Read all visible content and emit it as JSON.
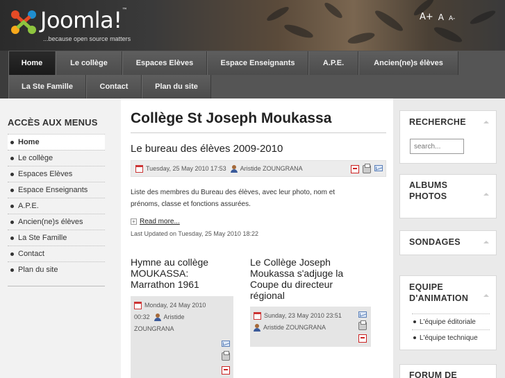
{
  "header": {
    "logo_text": "Joomla!",
    "logo_tm": "™",
    "tagline": "...because open source matters",
    "font_size": {
      "bigger": "A+",
      "reset": "A",
      "smaller": "A-"
    }
  },
  "nav": {
    "items": [
      {
        "label": "Home",
        "active": true
      },
      {
        "label": "Le collège"
      },
      {
        "label": "Espaces Elèves"
      },
      {
        "label": "Espace Enseignants"
      },
      {
        "label": "A.P.E."
      },
      {
        "label": "Ancien(ne)s élèves"
      },
      {
        "label": "La Ste Famille"
      },
      {
        "label": "Contact"
      },
      {
        "label": "Plan du site"
      }
    ]
  },
  "left": {
    "title": "ACCÈS AUX MENUS",
    "items": [
      "Home",
      "Le collège",
      "Espaces Elèves",
      "Espace Enseignants",
      "A.P.E.",
      "Ancien(ne)s élèves",
      "La Ste Famille",
      "Contact",
      "Plan du site"
    ]
  },
  "main": {
    "title": "Collège St Joseph Moukassa",
    "article": {
      "title": "Le bureau des élèves 2009-2010",
      "date": "Tuesday, 25 May 2010 17:53",
      "author": "Aristide ZOUNGRANA",
      "intro_line1": "Liste des membres du Bureau des élèves, avec leur photo, nom et",
      "intro_line2": "prénoms, classe et fonctions assurées.",
      "read_more": "Read more...",
      "last_updated": "Last Updated on Tuesday, 25 May 2010 18:22"
    },
    "col1": {
      "title_l1": "Hymne au collège",
      "title_l2": "MOUKASSA:",
      "title_l3": "Marrathon 1961",
      "date_l1": "Monday, 24 May 2010",
      "date_l2": "00:32",
      "author_l1": "Aristide",
      "author_l2": "ZOUNGRANA"
    },
    "col2": {
      "title_l1": "Le Collège Joseph",
      "title_l2": "Moukassa s'adjuge la",
      "title_l3": "Coupe du directeur",
      "title_l4": "régional",
      "date": "Sunday, 23 May 2010 23:51",
      "author": "Aristide ZOUNGRANA"
    }
  },
  "right": {
    "search": {
      "title": "RECHERCHE",
      "placeholder": "search..."
    },
    "albums": {
      "title_l1": "ALBUMS",
      "title_l2": "PHOTOS"
    },
    "polls": {
      "title": "SONDAGES"
    },
    "team": {
      "title_l1": "EQUIPE",
      "title_l2": "D'ANIMATION",
      "items": [
        "L'équipe éditoriale",
        "L'équipe technique"
      ]
    },
    "forum": {
      "title": "FORUM DE"
    }
  }
}
